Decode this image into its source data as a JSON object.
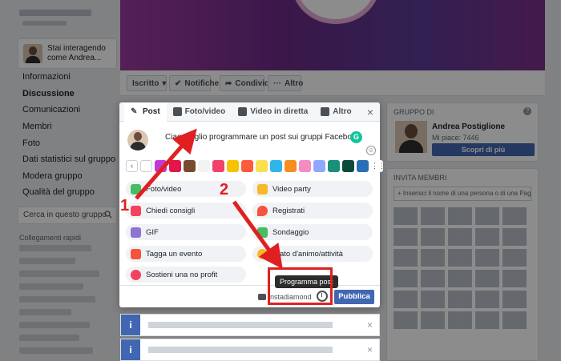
{
  "sidebar": {
    "acting_as": "Stai interagendo come Andrea...",
    "items": [
      {
        "label": "Informazioni",
        "active": false
      },
      {
        "label": "Discussione",
        "active": true
      },
      {
        "label": "Comunicazioni",
        "active": false
      },
      {
        "label": "Membri",
        "active": false
      },
      {
        "label": "Foto",
        "active": false
      },
      {
        "label": "Dati statistici sul gruppo",
        "active": false
      },
      {
        "label": "Modera gruppo",
        "active": false
      },
      {
        "label": "Qualità del gruppo",
        "active": false
      }
    ],
    "search_placeholder": "Cerca in questo gruppo",
    "quick_links_label": "Collegamenti rapidi"
  },
  "group_bar": {
    "iscritto": "Iscritto",
    "notifiche": "Notifiche",
    "condividi": "Condividi",
    "altro": "Altro"
  },
  "composer": {
    "tabs": [
      {
        "label": "Post",
        "icon": "pencil-icon"
      },
      {
        "label": "Foto/video",
        "icon": "photo-icon"
      },
      {
        "label": "Video in diretta",
        "icon": "live-video-icon"
      },
      {
        "label": "Altro",
        "icon": "more-icon"
      }
    ],
    "text": "Ciao, voglio programmare un post sui gruppi Facebook.",
    "grammarly": "G",
    "options_left": [
      {
        "label": "Foto/video",
        "icon": "photo-icon",
        "color": "#45bd62"
      },
      {
        "label": "Chiedi consigli",
        "icon": "recommend-icon",
        "color": "#f3425f"
      },
      {
        "label": "GIF",
        "icon": "gif-icon",
        "color": "#8c73d4"
      },
      {
        "label": "Tagga un evento",
        "icon": "calendar-icon",
        "color": "#f5533d"
      },
      {
        "label": "Sostieni una no profit",
        "icon": "fundraiser-icon",
        "color": "#f3425f"
      }
    ],
    "options_right": [
      {
        "label": "Video party",
        "icon": "video-party-icon",
        "color": "#f7b928"
      },
      {
        "label": "Registrati",
        "icon": "checkin-icon",
        "color": "#f5533d"
      },
      {
        "label": "Sondaggio",
        "icon": "poll-icon",
        "color": "#45bd62"
      },
      {
        "label": "Stato d'animo/attività",
        "icon": "feeling-icon",
        "color": "#f7b928"
      }
    ],
    "instagram_label": "instadiamond",
    "publish_label": "Pubblica",
    "tooltip": "Programma post"
  },
  "right_col": {
    "gruppo_di_title": "GRUPPO DI",
    "owner_name": "Andrea Postiglione",
    "likes": "Mi piace: 7446",
    "learn_more": "Scopri di più",
    "invite_title": "INVITA MEMBRI",
    "invite_placeholder": "+ Inserisci il nome di una persona o di una Pagina..."
  },
  "annotations": {
    "step1": "1",
    "step2": "2",
    "color": "#e02020"
  },
  "colors": {
    "brand": "#4267b2",
    "highlight": "#e02020"
  }
}
